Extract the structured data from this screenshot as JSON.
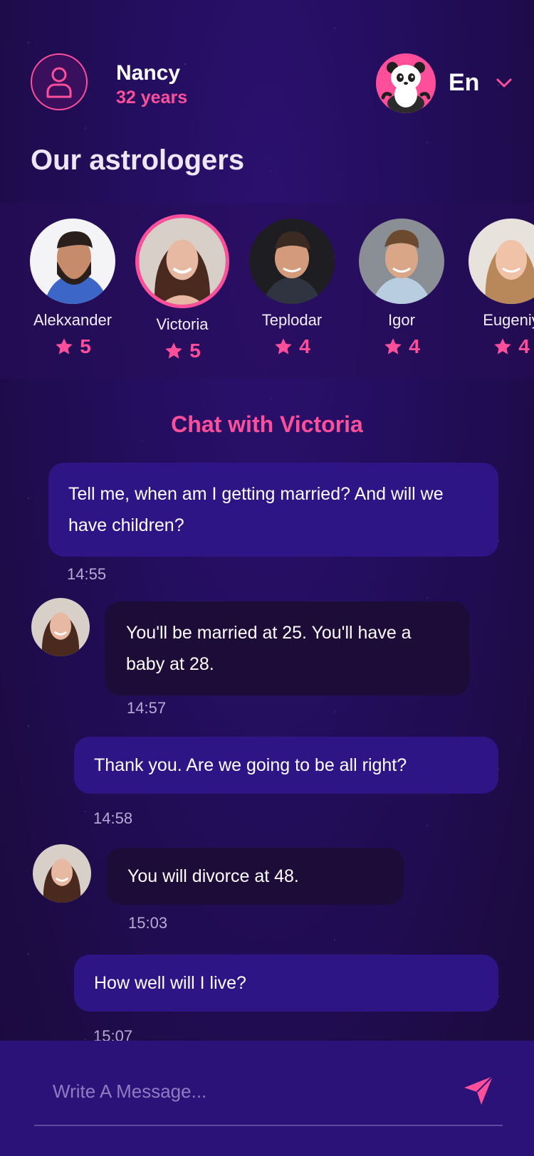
{
  "header": {
    "user_name": "Nancy",
    "user_age": "32 years",
    "language": "En"
  },
  "section_title": "Our astrologers",
  "astrologers": [
    {
      "name": "Alekxander",
      "rating": "5",
      "selected": false
    },
    {
      "name": "Victoria",
      "rating": "5",
      "selected": true
    },
    {
      "name": "Teplodar",
      "rating": "4",
      "selected": false
    },
    {
      "name": "Igor",
      "rating": "4",
      "selected": false
    },
    {
      "name": "Eugeniy",
      "rating": "4",
      "selected": false
    }
  ],
  "chat": {
    "title": "Chat with Victoria",
    "messages": [
      {
        "from": "user",
        "text": "Tell me, when am I getting married? And will we have children?",
        "time": "14:55"
      },
      {
        "from": "astrologer",
        "text": "You'll be married at 25. You'll have a baby at 28.",
        "time": "14:57"
      },
      {
        "from": "user",
        "text": "Thank you. Are we going to be all right?",
        "time": "14:58"
      },
      {
        "from": "astrologer",
        "text": "You will divorce at 48.",
        "time": "15:03"
      },
      {
        "from": "user",
        "text": "How well will I live?",
        "time": "15:07"
      }
    ]
  },
  "composer": {
    "placeholder": "Write A Message..."
  },
  "colors": {
    "accent": "#ff4f9a",
    "bubble_user": "#2d1585",
    "bubble_astrologer": "#1d0b38",
    "background": "#220d5a"
  },
  "icons": [
    "user-icon",
    "panda-logo-icon",
    "chevron-down-icon",
    "star-icon",
    "send-icon"
  ]
}
